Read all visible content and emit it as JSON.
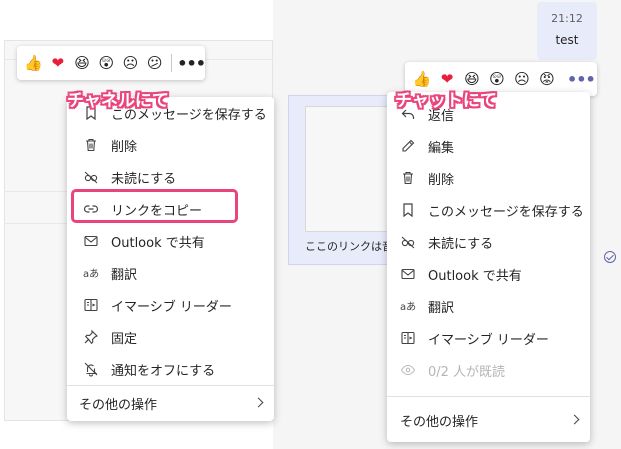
{
  "chat": {
    "message_time": "21:12",
    "message_text": "test",
    "link_text": "ここのリンクは音"
  },
  "annotations": {
    "channel_label": "チャネルにて",
    "chat_label": "チャットにて",
    "accent_color": "#e9457b"
  },
  "channel_reactions": [
    "like",
    "heart",
    "laugh",
    "surprised",
    "sad",
    "angry"
  ],
  "chat_reactions": [
    "like",
    "heart",
    "laugh",
    "surprised",
    "sad",
    "angry"
  ],
  "channel_menu": {
    "items": [
      {
        "label": "このメッセージを保存する",
        "icon": "bookmark-icon"
      },
      {
        "label": "削除",
        "icon": "trash-icon"
      },
      {
        "label": "未読にする",
        "icon": "unread-icon"
      },
      {
        "label": "リンクをコピー",
        "icon": "link-icon"
      },
      {
        "label": "Outlook で共有",
        "icon": "mail-icon"
      },
      {
        "label": "翻訳",
        "icon": "translate-icon"
      },
      {
        "label": "イマーシブ リーダー",
        "icon": "immersive-reader-icon"
      },
      {
        "label": "固定",
        "icon": "pin-icon"
      },
      {
        "label": "通知をオフにする",
        "icon": "bell-off-icon"
      }
    ],
    "more_label": "その他の操作"
  },
  "chat_menu": {
    "items": [
      {
        "label": "返信",
        "icon": "reply-icon"
      },
      {
        "label": "編集",
        "icon": "pencil-icon"
      },
      {
        "label": "削除",
        "icon": "trash-icon"
      },
      {
        "label": "このメッセージを保存する",
        "icon": "bookmark-icon"
      },
      {
        "label": "未読にする",
        "icon": "unread-icon"
      },
      {
        "label": "Outlook で共有",
        "icon": "mail-icon"
      },
      {
        "label": "翻訳",
        "icon": "translate-icon"
      },
      {
        "label": "イマーシブ リーダー",
        "icon": "immersive-reader-icon"
      },
      {
        "label": "0/2 人が既読",
        "icon": "eye-icon",
        "disabled": true
      }
    ],
    "more_label": "その他の操作"
  }
}
